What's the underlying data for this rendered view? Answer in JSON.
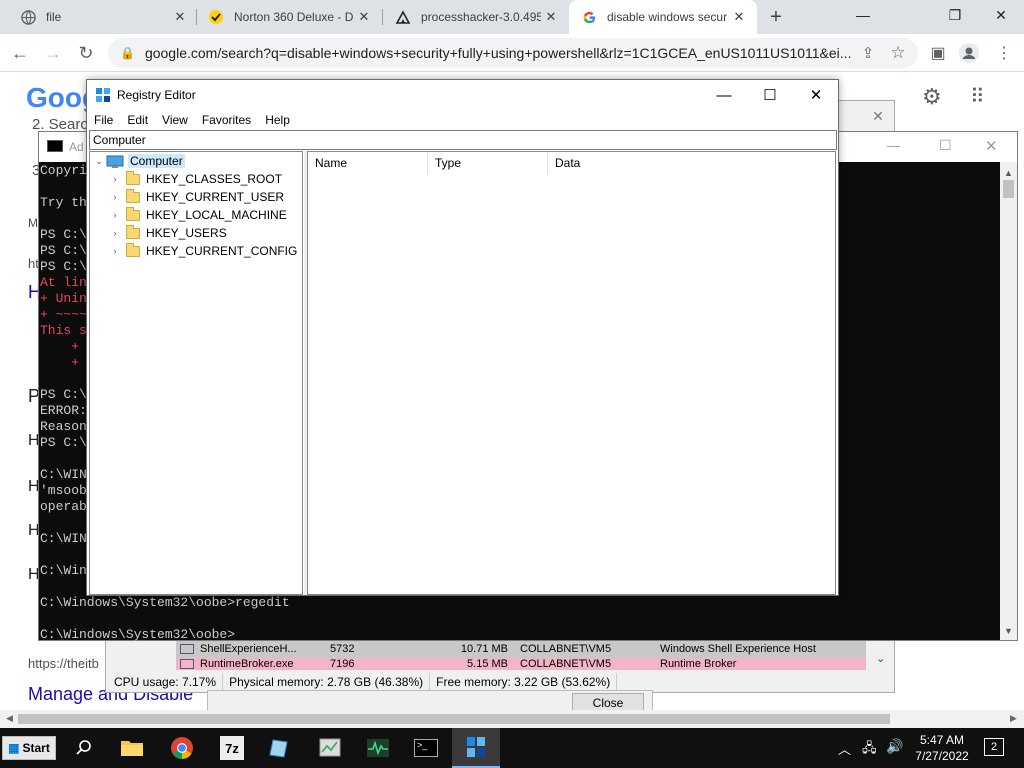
{
  "browser": {
    "tabs": [
      {
        "title": "file",
        "icon": "globe-icon"
      },
      {
        "title": "Norton 360 Deluxe - D",
        "icon": "norton-icon"
      },
      {
        "title": "processhacker-3.0.495",
        "icon": "sourceforge-icon"
      },
      {
        "title": "disable windows secur",
        "icon": "google-icon"
      }
    ],
    "new_tab": "+",
    "url": "google.com/search?q=disable+windows+security+fully+using+powershell&rlz=1C1GCEA_enUS1011US1011&ei..."
  },
  "google_page": {
    "logo": "Goog",
    "fragments": [
      "2. Searc",
      "3",
      "M",
      "ht",
      "H",
      "P",
      "H",
      "H",
      "H",
      "H"
    ],
    "footer_url": "https://theitb",
    "footer_link": "Manage and Disable"
  },
  "powershell": {
    "title": "Ad",
    "lines": [
      {
        "text": "Copyri",
        "style": "normal"
      },
      {
        "text": "",
        "style": "normal"
      },
      {
        "text": "Try th",
        "style": "normal"
      },
      {
        "text": "",
        "style": "normal"
      },
      {
        "text": "PS C:\\",
        "style": "normal"
      },
      {
        "text": "PS C:\\",
        "style": "normal"
      },
      {
        "text": "PS C:\\",
        "style": "normal"
      },
      {
        "text": "At lin",
        "style": "red"
      },
      {
        "text": "+ Unin",
        "style": "red"
      },
      {
        "text": "+ ~~~~",
        "style": "red"
      },
      {
        "text": "This s",
        "style": "red"
      },
      {
        "text": "    +",
        "style": "red"
      },
      {
        "text": "    +",
        "style": "red"
      },
      {
        "text": "",
        "style": "normal"
      },
      {
        "text": "PS C:\\",
        "style": "normal"
      },
      {
        "text": "ERROR:",
        "style": "normal"
      },
      {
        "text": "Reason",
        "style": "normal"
      },
      {
        "text": "PS C:\\",
        "style": "normal"
      },
      {
        "text": "",
        "style": "normal"
      },
      {
        "text": "C:\\WIN",
        "style": "normal"
      },
      {
        "text": "'msoob",
        "style": "normal"
      },
      {
        "text": "operab",
        "style": "normal"
      },
      {
        "text": "",
        "style": "normal"
      },
      {
        "text": "C:\\WIN",
        "style": "normal"
      },
      {
        "text": "",
        "style": "normal"
      },
      {
        "text": "C:\\Win",
        "style": "normal"
      },
      {
        "text": "",
        "style": "normal"
      },
      {
        "text": "C:\\Windows\\System32\\oobe>regedit",
        "style": "normal"
      },
      {
        "text": "",
        "style": "normal"
      },
      {
        "text": "C:\\Windows\\System32\\oobe>",
        "style": "normal"
      }
    ]
  },
  "process_hacker": {
    "rows": [
      {
        "name": "ShellExperienceH...",
        "pid": "5732",
        "mem": "10.71 MB",
        "user": "COLLABNET\\VM5",
        "desc": "Windows Shell Experience Host",
        "highlight": "#c8c8c8"
      },
      {
        "name": "RuntimeBroker.exe",
        "pid": "7196",
        "mem": "5.15 MB",
        "user": "COLLABNET\\VM5",
        "desc": "Runtime Broker",
        "highlight": "#f4b4c8"
      }
    ],
    "status": {
      "cpu": "CPU usage: 7.17%",
      "physical": "Physical memory: 2.78 GB (46.38%)",
      "free": "Free memory: 3.22 GB (53.62%)"
    },
    "close_button": "Close"
  },
  "regedit": {
    "title": "Registry Editor",
    "menu": [
      "File",
      "Edit",
      "View",
      "Favorites",
      "Help"
    ],
    "address": "Computer",
    "root": "Computer",
    "keys": [
      "HKEY_CLASSES_ROOT",
      "HKEY_CURRENT_USER",
      "HKEY_LOCAL_MACHINE",
      "HKEY_USERS",
      "HKEY_CURRENT_CONFIG"
    ],
    "columns": [
      "Name",
      "Type",
      "Data"
    ]
  },
  "taskbar": {
    "start": "Start",
    "apps": [
      "search-icon",
      "file-explorer-icon",
      "chrome-icon",
      "7zip-icon",
      "notepad-icon",
      "regedit-app-icon",
      "process-hacker-icon",
      "cmd-icon",
      "registry-editor-icon"
    ],
    "time": "5:47 AM",
    "date": "7/27/2022",
    "notifications": "2"
  }
}
